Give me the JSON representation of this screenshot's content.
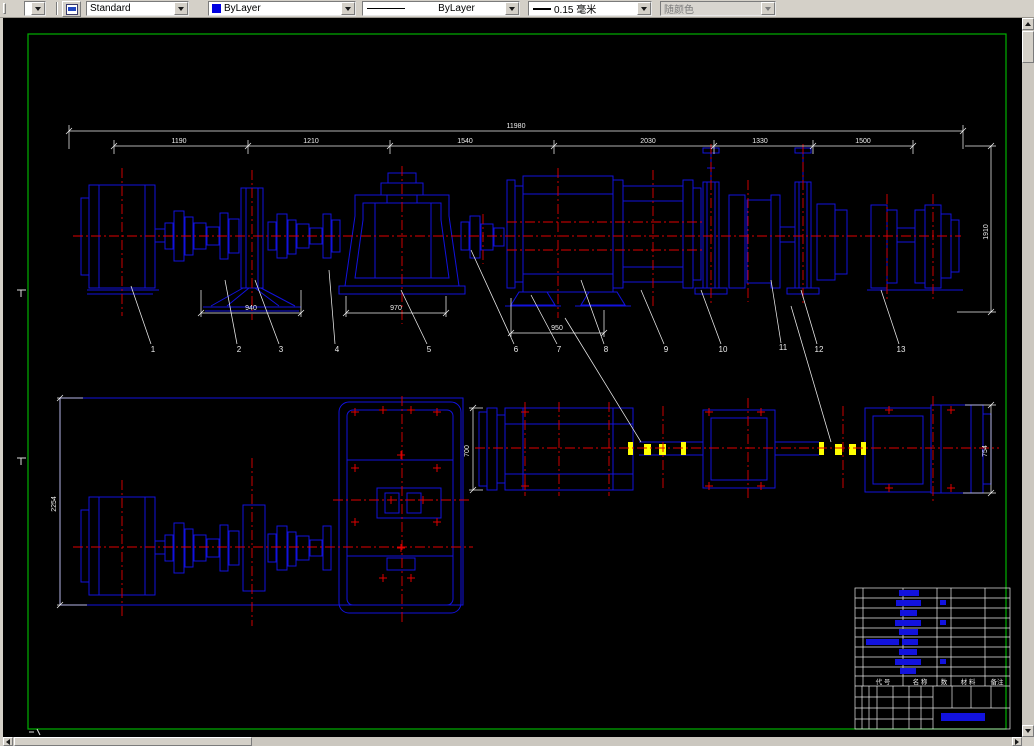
{
  "toolbar": {
    "style_value": "Standard",
    "color_value": "ByLayer",
    "linetype_value": "ByLayer",
    "lineweight_value": "0.15 毫米",
    "plotstyle_value": "随颜色"
  },
  "drawing": {
    "overall_dim": "11980",
    "segment_dims": [
      "1190",
      "1210",
      "1540",
      "2030",
      "1330",
      "1500"
    ],
    "dim_940": "940",
    "dim_970": "970",
    "dim_950": "950",
    "dim_1910": "1910",
    "dim_2254": "2254",
    "dim_700": "700",
    "dim_754": "754",
    "part_labels": [
      "1",
      "2",
      "3",
      "4",
      "5",
      "6",
      "7",
      "8",
      "9",
      "10",
      "11",
      "12",
      "13"
    ]
  },
  "title_block": {
    "col_code": "代 号",
    "col_name": "名 称",
    "col_qty": "数",
    "col_material": "材 料",
    "col_remark": "备注"
  },
  "colors": {
    "geometry_blue": "#1212dd",
    "centerline_red": "#e00000",
    "frame_green": "#00b000",
    "dimension_white": "#ededed",
    "highlight_yellow": "#ffff00"
  }
}
